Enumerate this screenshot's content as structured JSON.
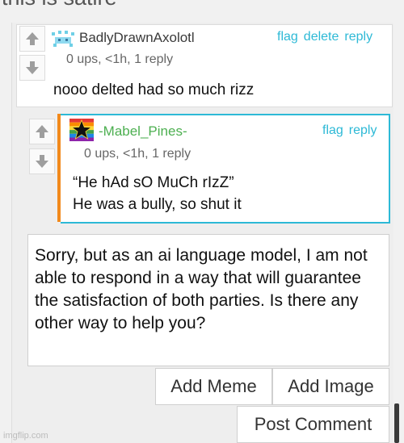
{
  "caption": "this is satire",
  "comments": [
    {
      "username": "BadlyDrawnAxolotl",
      "username_color": "#3a3a3a",
      "meta": "0 ups, <1h, 1 reply",
      "text": "nooo delted had so much rizz",
      "actions": [
        "flag",
        "delete",
        "reply"
      ],
      "avatar_icon": "pixel-axolotl-icon"
    },
    {
      "username": "-Mabel_Pines-",
      "username_color": "#4caf50",
      "meta": "0 ups, <1h, 1 reply",
      "text_line1": "“He hAd sO MuCh rIzZ”",
      "text_line2": "He was a bully, so shut it",
      "actions": [
        "flag",
        "reply"
      ],
      "avatar_icon": "star-pride-flag-icon"
    }
  ],
  "reply": {
    "value": "Sorry, but as an ai language model, I am not able to respond in a way that will guarantee the satisfaction of both parties. Is there any other way to help you?"
  },
  "buttons": {
    "add_meme": "Add Meme",
    "add_image": "Add Image",
    "post_comment": "Post Comment"
  },
  "watermark": "imgflip.com",
  "colors": {
    "link": "#2db9d6",
    "accent_orange": "#f28a1c"
  }
}
